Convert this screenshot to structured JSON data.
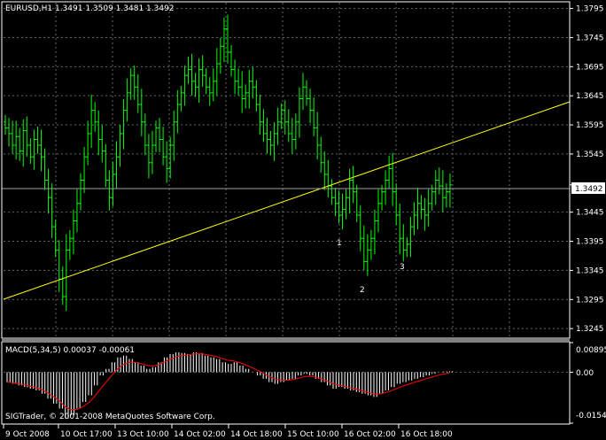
{
  "header": {
    "symbol_line": "EURUSD,H1  1.3491 1.3509 1.3481 1.3492"
  },
  "macd": {
    "label": "MACD(5,34,5) 0.00037 -0.00061",
    "scale_top": "0.00895",
    "scale_mid": "0.00",
    "scale_bottom": "-0.01543"
  },
  "footer": {
    "copyright": "SIGTrader, © 2001-2008 MetaQuotes Software Corp."
  },
  "annotations": {
    "n1": "1",
    "n2": "2",
    "n3": "3"
  },
  "colors": {
    "background": "#000000",
    "candle": "#00ff00",
    "grid": "#5a6a6a",
    "trendline": "#ffff00",
    "macd_hist": "#ffffff",
    "macd_signal": "#ff0000",
    "bid_line": "#a0a0a0",
    "price_box": "#ffffff"
  },
  "chart_data": {
    "type": "candlestick",
    "symbol": "EURUSD",
    "timeframe": "H1",
    "current_price": "1.3492",
    "price_ticks": [
      "1.3795",
      "1.3745",
      "1.3695",
      "1.3645",
      "1.3595",
      "1.3545",
      "1.3492",
      "1.3445",
      "1.3395",
      "1.3345",
      "1.3295",
      "1.3245"
    ],
    "time_ticks": [
      "9 Oct 2008",
      "10 Oct 17:00",
      "13 Oct 10:00",
      "14 Oct 02:00",
      "14 Oct 18:00",
      "15 Oct 10:00",
      "16 Oct 02:00",
      "16 Oct 18:00"
    ],
    "ylim": [
      1.323,
      1.3805
    ],
    "closes": [
      1.359,
      1.358,
      1.356,
      1.3575,
      1.355,
      1.3585,
      1.356,
      1.354,
      1.357,
      1.356,
      1.354,
      1.35,
      1.347,
      1.342,
      1.338,
      1.333,
      1.33,
      1.338,
      1.34,
      1.343,
      1.346,
      1.35,
      1.354,
      1.358,
      1.362,
      1.36,
      1.357,
      1.355,
      1.35,
      1.347,
      1.351,
      1.354,
      1.358,
      1.362,
      1.365,
      1.368,
      1.366,
      1.363,
      1.36,
      1.356,
      1.353,
      1.356,
      1.359,
      1.357,
      1.354,
      1.352,
      1.356,
      1.36,
      1.363,
      1.365,
      1.368,
      1.369,
      1.367,
      1.366,
      1.369,
      1.368,
      1.366,
      1.365,
      1.367,
      1.37,
      1.373,
      1.376,
      1.372,
      1.369,
      1.367,
      1.366,
      1.364,
      1.365,
      1.367,
      1.366,
      1.363,
      1.36,
      1.358,
      1.357,
      1.356,
      1.358,
      1.36,
      1.362,
      1.36,
      1.358,
      1.357,
      1.36,
      1.364,
      1.366,
      1.364,
      1.362,
      1.359,
      1.356,
      1.353,
      1.351,
      1.349,
      1.347,
      1.346,
      1.344,
      1.345,
      1.347,
      1.35,
      1.348,
      1.344,
      1.34,
      1.336,
      1.338,
      1.34,
      1.343,
      1.346,
      1.348,
      1.35,
      1.352,
      1.348,
      1.344,
      1.34,
      1.338,
      1.339,
      1.342,
      1.344,
      1.346,
      1.345,
      1.344,
      1.346,
      1.348,
      1.35,
      1.349,
      1.347,
      1.348,
      1.3492
    ],
    "macd_hist": [
      -0.003,
      -0.0035,
      -0.004,
      -0.0045,
      -0.005,
      -0.0055,
      -0.0065,
      -0.008,
      -0.0095,
      -0.011,
      -0.014,
      -0.013,
      -0.011,
      -0.009,
      -0.007,
      -0.004,
      -0.001,
      0.001,
      0.003,
      0.0045,
      0.005,
      0.004,
      0.003,
      0.002,
      0.001,
      0.0015,
      0.003,
      0.0045,
      0.0055,
      0.006,
      0.0058,
      0.0055,
      0.006,
      0.0058,
      0.005,
      0.0045,
      0.004,
      0.003,
      0.0025,
      0.003,
      0.002,
      0.001,
      0.0,
      -0.001,
      -0.002,
      -0.003,
      -0.0035,
      -0.003,
      -0.0025,
      -0.002,
      -0.001,
      -0.0005,
      -0.001,
      -0.002,
      -0.003,
      -0.004,
      -0.005,
      -0.0045,
      -0.005,
      -0.0055,
      -0.006,
      -0.0065,
      -0.007,
      -0.0075,
      -0.0065,
      -0.0055,
      -0.0045,
      -0.0035,
      -0.003,
      -0.0025,
      -0.002,
      -0.0015,
      -0.001,
      -0.0005,
      0.0,
      0.0002,
      0.0003
    ],
    "annotation_labels": [
      "1",
      "2",
      "3"
    ]
  }
}
